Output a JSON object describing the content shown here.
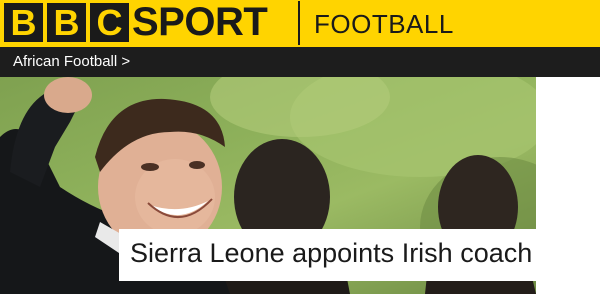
{
  "header": {
    "logo_letters": [
      "B",
      "B",
      "C"
    ],
    "sport_word": "SPORT",
    "section": "FOOTBALL",
    "brand_yellow": "#ffd400",
    "brand_dark": "#1a1a1a"
  },
  "breadcrumb": {
    "label": "African Football",
    "arrow": ">",
    "icon": "chevron-right-icon"
  },
  "story": {
    "headline": "Sierra Leone appoints Irish coach"
  }
}
